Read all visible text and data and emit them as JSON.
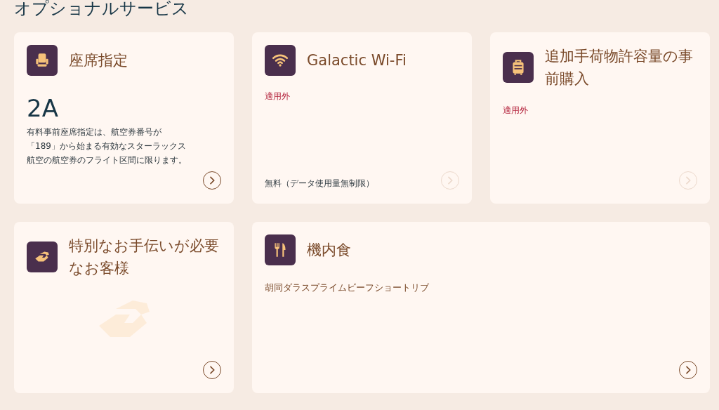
{
  "heading": "オプショナルサービス",
  "cards": [
    {
      "kind": "seat",
      "title": "座席指定",
      "value": "2A",
      "note": "有料事前座席指定は、航空券番号が「189」から始まる有効なスターラックス航空の航空券のフライト区間に限ります。",
      "disabled": false
    },
    {
      "kind": "wifi",
      "title": "Galactic Wi-Fi",
      "status": "適用外",
      "footer": "無料（データ使用量無制限）",
      "disabled": true
    },
    {
      "kind": "baggage",
      "title": "追加手荷物許容量の事前購入",
      "status": "適用外",
      "disabled": true
    },
    {
      "kind": "assistance",
      "title": "特別なお手伝いが必要なお客様",
      "disabled": false
    },
    {
      "kind": "meal",
      "title": "機内食",
      "detail": "胡同ダラスプライムビーフショートリブ",
      "disabled": false
    }
  ]
}
